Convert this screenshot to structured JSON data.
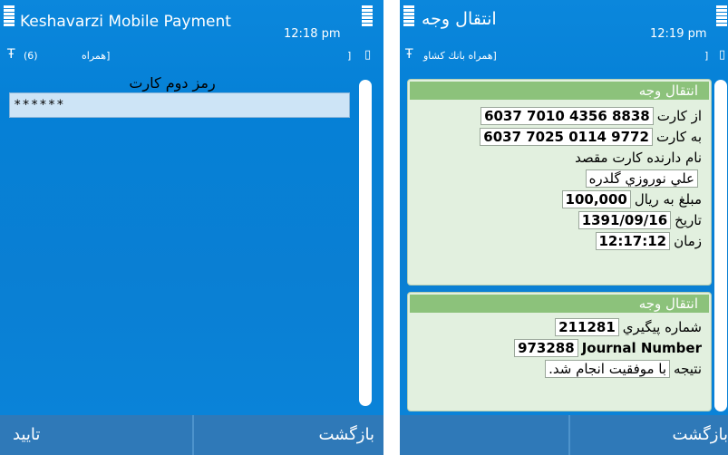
{
  "left": {
    "title": "Keshavarzi Mobile Payment",
    "clock": "12:18 pm",
    "signal_glyph": "Ŧ",
    "subbar_count": "(6)",
    "subbar_text": "همراه]",
    "subbar_bracket": "]",
    "battery_glyph": "▯",
    "password_label": "رمز دوم كارت",
    "password_value": "******",
    "softkey_left": "تایید",
    "softkey_right": "بازگشت"
  },
  "right": {
    "title": "انتقال وجه",
    "clock": "12:19 pm",
    "signal_glyph": "Ŧ",
    "subbar_text": "همراه بانك كشاو]",
    "subbar_bracket": "]",
    "battery_glyph": "▯",
    "panel1": {
      "header": "انتقال وجه",
      "from_card_label": "از كارت",
      "from_card": "6037 7010 4356 8838",
      "to_card_label": "به كارت",
      "to_card": "6037 7025 0114 9772",
      "holder_label": "نام دارنده كارت مقصد",
      "holder_name": "علي نوروزي گلدره",
      "amount_label": "مبلغ به ريال",
      "amount": "100,000",
      "date_label": "تاريخ",
      "date": "1391/09/16",
      "time_label": "زمان",
      "time": "12:17:12"
    },
    "panel2": {
      "header": "انتقال وجه",
      "tracking_label": "شماره پيگيري",
      "tracking": "211281",
      "journal_label": "Journal Number",
      "journal": "973288",
      "result_label": "نتيجه",
      "result": "با موفقيت انجام شد."
    },
    "softkey_right": "بازگشت"
  }
}
